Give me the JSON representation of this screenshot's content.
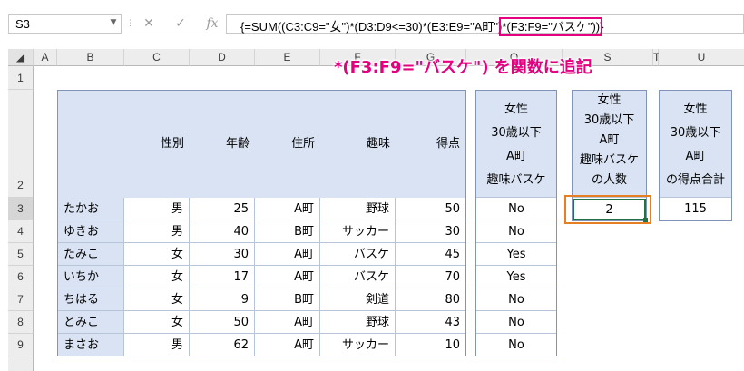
{
  "formula_bar": {
    "name_box": "S3",
    "cancel_icon": "✕",
    "enter_icon": "✓",
    "fx_label": "fx",
    "formula_prefix": "{=SUM((C3:C9=\"女\")*(D3:D9<=30)*(E3:E9=\"A町\")",
    "formula_highlight": "*(F3:F9=\"バスケ\"))",
    "formula_suffix": "}"
  },
  "columns": [
    "A",
    "B",
    "C",
    "D",
    "E",
    "F",
    "G",
    "O",
    "S",
    "T",
    "U"
  ],
  "rows": [
    "1",
    "2",
    "3",
    "4",
    "5",
    "6",
    "7",
    "8",
    "9"
  ],
  "callout": "*(F3:F9=\"バスケ\") を関数に追記",
  "table": {
    "headers": [
      "",
      "性別",
      "年齢",
      "住所",
      "趣味",
      "得点"
    ],
    "rows": [
      [
        "たかお",
        "男",
        "25",
        "A町",
        "野球",
        "50"
      ],
      [
        "ゆきお",
        "男",
        "40",
        "B町",
        "サッカー",
        "30"
      ],
      [
        "たみこ",
        "女",
        "30",
        "A町",
        "バスケ",
        "45"
      ],
      [
        "いちか",
        "女",
        "17",
        "A町",
        "バスケ",
        "70"
      ],
      [
        "ちはる",
        "女",
        "9",
        "B町",
        "剣道",
        "80"
      ],
      [
        "とみこ",
        "女",
        "50",
        "A町",
        "野球",
        "43"
      ],
      [
        "まさお",
        "男",
        "62",
        "A町",
        "サッカー",
        "10"
      ]
    ]
  },
  "o_col": {
    "header_lines": [
      "女性",
      "30歳以下",
      "A町",
      "趣味バスケ"
    ],
    "values": [
      "No",
      "No",
      "Yes",
      "Yes",
      "No",
      "No",
      "No"
    ]
  },
  "s_col": {
    "header_lines": [
      "女性",
      "30歳以下",
      "A町",
      "趣味バスケ",
      "の人数"
    ],
    "value": "2"
  },
  "u_col": {
    "header_lines": [
      "女性",
      "30歳以下",
      "A町",
      "の得点合計"
    ],
    "value": "115"
  },
  "colors": {
    "header_fill": "#dae3f3",
    "highlight": "#e4007f",
    "active_cell": "#e67e22",
    "selected_cell": "#217346"
  }
}
